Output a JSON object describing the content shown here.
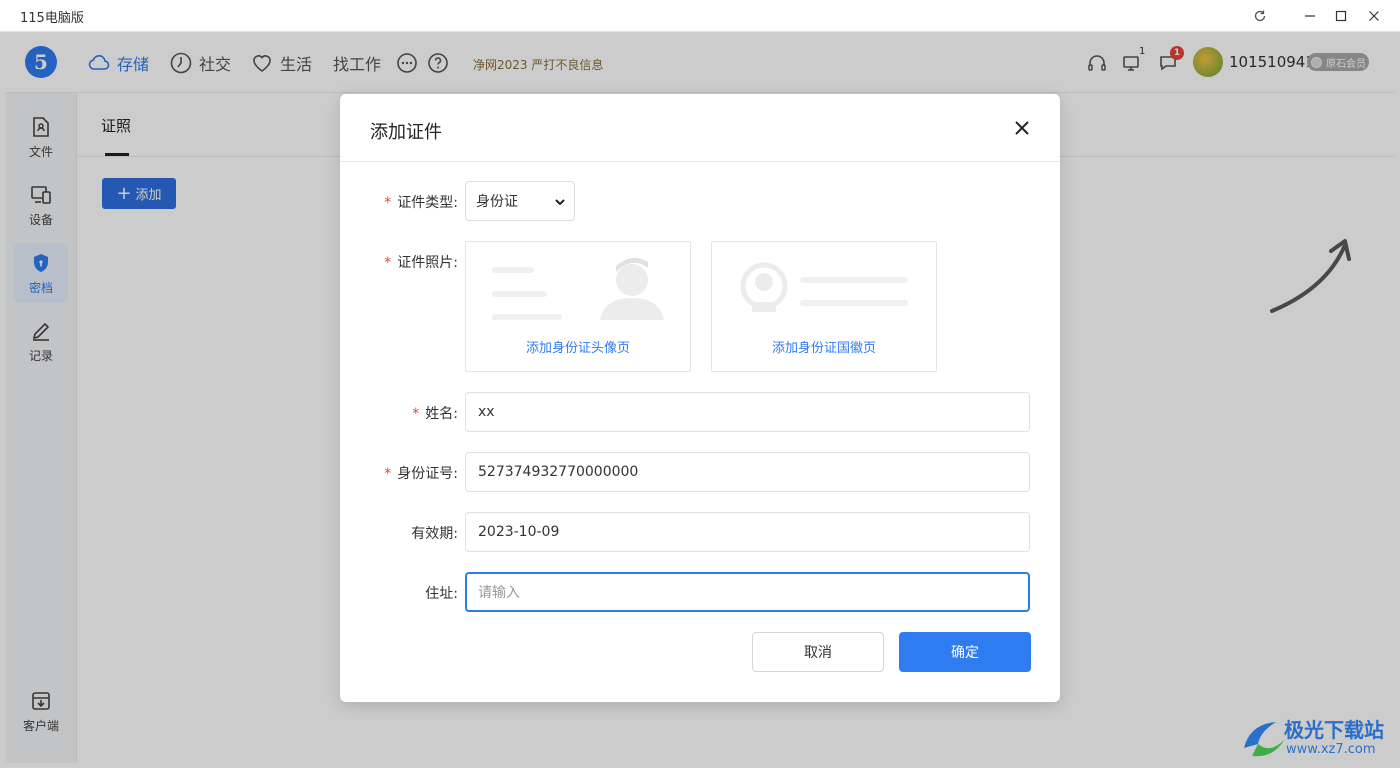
{
  "window": {
    "title": "115电脑版"
  },
  "nav": {
    "items": [
      {
        "label": "存储",
        "icon": "cloud-icon"
      },
      {
        "label": "社交",
        "icon": "clock-icon"
      },
      {
        "label": "生活",
        "icon": "heart-icon"
      },
      {
        "label": "找工作"
      }
    ],
    "notice": "净网2023 严打不良信息",
    "device_count": "1",
    "message_count": "1",
    "user_id": "101510941",
    "vip_label": "原石会员"
  },
  "sidebar": {
    "items": [
      {
        "label": "文件",
        "icon": "file-icon"
      },
      {
        "label": "设备",
        "icon": "device-icon"
      },
      {
        "label": "密档",
        "icon": "shield-icon"
      },
      {
        "label": "记录",
        "icon": "pencil-icon"
      }
    ],
    "client_label": "客户端"
  },
  "content": {
    "tab_label": "证照",
    "add_label": "添加"
  },
  "dialog": {
    "title": "添加证件",
    "type_label": "证件类型:",
    "type_value": "身份证",
    "photo_label": "证件照片:",
    "photo_front": "添加身份证头像页",
    "photo_back": "添加身份证国徽页",
    "name_label": "姓名:",
    "name_value": "xx",
    "id_label": "身份证号:",
    "id_value": "527374932770000000",
    "expiry_label": "有效期:",
    "expiry_value": "2023-10-09",
    "address_label": "住址:",
    "address_placeholder": "请输入",
    "cancel_label": "取消",
    "confirm_label": "确定",
    "required_mark": "*"
  },
  "watermark": {
    "text": "极光下载站",
    "url": "www.xz7.com"
  },
  "colors": {
    "accent": "#2f7bf0",
    "required": "#e5433b",
    "overlay": "rgba(0,0,0,0.2)"
  }
}
